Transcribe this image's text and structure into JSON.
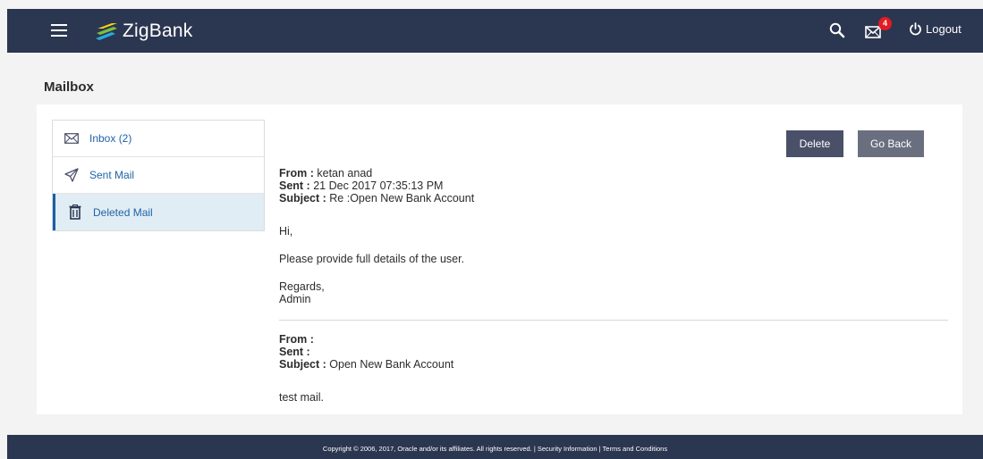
{
  "header": {
    "brand": "ZigBank",
    "mail_badge_count": "4",
    "logout_label": "Logout",
    "colors": {
      "bar": "#2b3650",
      "badge": "#e31b23"
    }
  },
  "page": {
    "title": "Mailbox"
  },
  "sidebar": {
    "items": [
      {
        "label": "Inbox (2)",
        "icon": "envelope-icon"
      },
      {
        "label": "Sent Mail",
        "icon": "paper-plane-icon"
      },
      {
        "label": "Deleted Mail",
        "icon": "trash-icon",
        "active": true
      }
    ]
  },
  "actions": {
    "delete_label": "Delete",
    "back_label": "Go Back"
  },
  "message": {
    "from_label": "From :",
    "from_value": "ketan anad",
    "sent_label": "Sent :",
    "sent_value": "21 Dec 2017 07:35:13 PM",
    "subject_label": "Subject :",
    "subject_value": "Re :Open New Bank Account",
    "body": {
      "greeting": "Hi,",
      "text": "Please provide full details of the user.",
      "closing": "Regards,",
      "signature": "Admin"
    }
  },
  "original": {
    "from_label": "From :",
    "sent_label": "Sent :",
    "subject_label": "Subject :",
    "subject_value": "Open New Bank Account",
    "body": "test mail."
  },
  "footer": {
    "text": "Copyright © 2006, 2017, Oracle and/or its affiliates. All rights reserved. | Security Information | Terms and Conditions"
  }
}
